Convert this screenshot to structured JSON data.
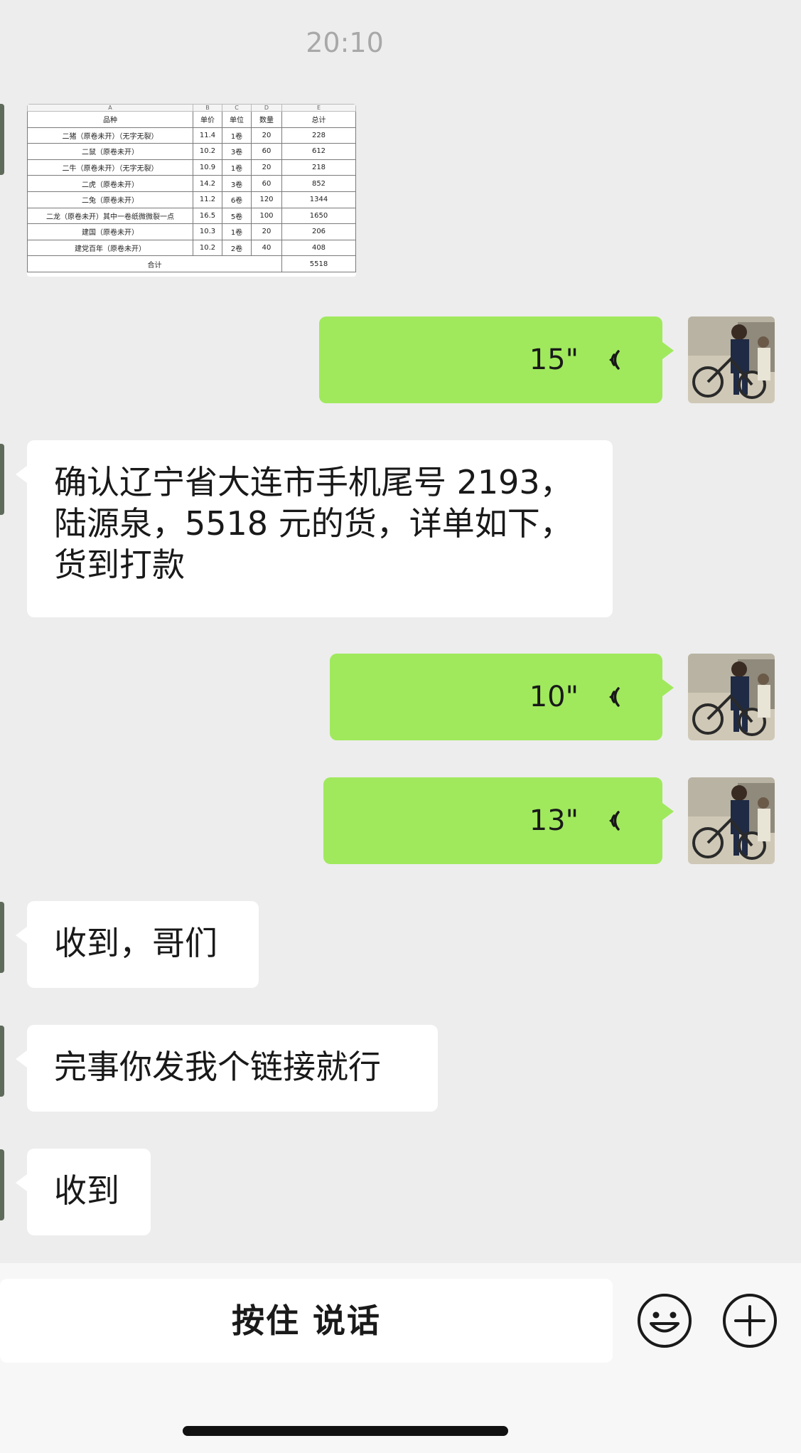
{
  "status": {
    "time": "20:10"
  },
  "spreadsheet": {
    "col_letters": [
      "A",
      "B",
      "C",
      "D",
      "E"
    ],
    "header": [
      "品种",
      "单价",
      "单位",
      "数量",
      "总计"
    ],
    "rows": [
      [
        "二猪（原卷未开）（无字无裂）",
        "11.4",
        "1卷",
        "20",
        "228"
      ],
      [
        "二鼠（原卷未开）",
        "10.2",
        "3卷",
        "60",
        "612"
      ],
      [
        "二牛（原卷未开）（无字无裂）",
        "10.9",
        "1卷",
        "20",
        "218"
      ],
      [
        "二虎（原卷未开）",
        "14.2",
        "3卷",
        "60",
        "852"
      ],
      [
        "二兔（原卷未开）",
        "11.2",
        "6卷",
        "120",
        "1344"
      ],
      [
        "二龙（原卷未开）其中一卷纸微微裂一点",
        "16.5",
        "5卷",
        "100",
        "1650"
      ],
      [
        "建国（原卷未开）",
        "10.3",
        "1卷",
        "20",
        "206"
      ],
      [
        "建党百年（原卷未开）",
        "10.2",
        "2卷",
        "40",
        "408"
      ]
    ],
    "total_label": "合计",
    "total_value": "5518"
  },
  "messages": {
    "voice1": "15\"",
    "text1": "确认辽宁省大连市手机尾号 2193，陆源泉，5518 元的货，详单如下，货到打款",
    "voice2": "10\"",
    "voice3": "13\"",
    "text2": "收到，哥们",
    "text3": "完事你发我个链接就行",
    "text4": "收到"
  },
  "input_bar": {
    "hold_to_talk": "按住 说话"
  },
  "icons": {
    "voice": "voice-wave-icon",
    "emoji": "emoji-icon",
    "plus": "plus-icon"
  },
  "colors": {
    "background": "#ededed",
    "sent_bubble": "#a0e95d",
    "received_bubble": "#ffffff"
  }
}
